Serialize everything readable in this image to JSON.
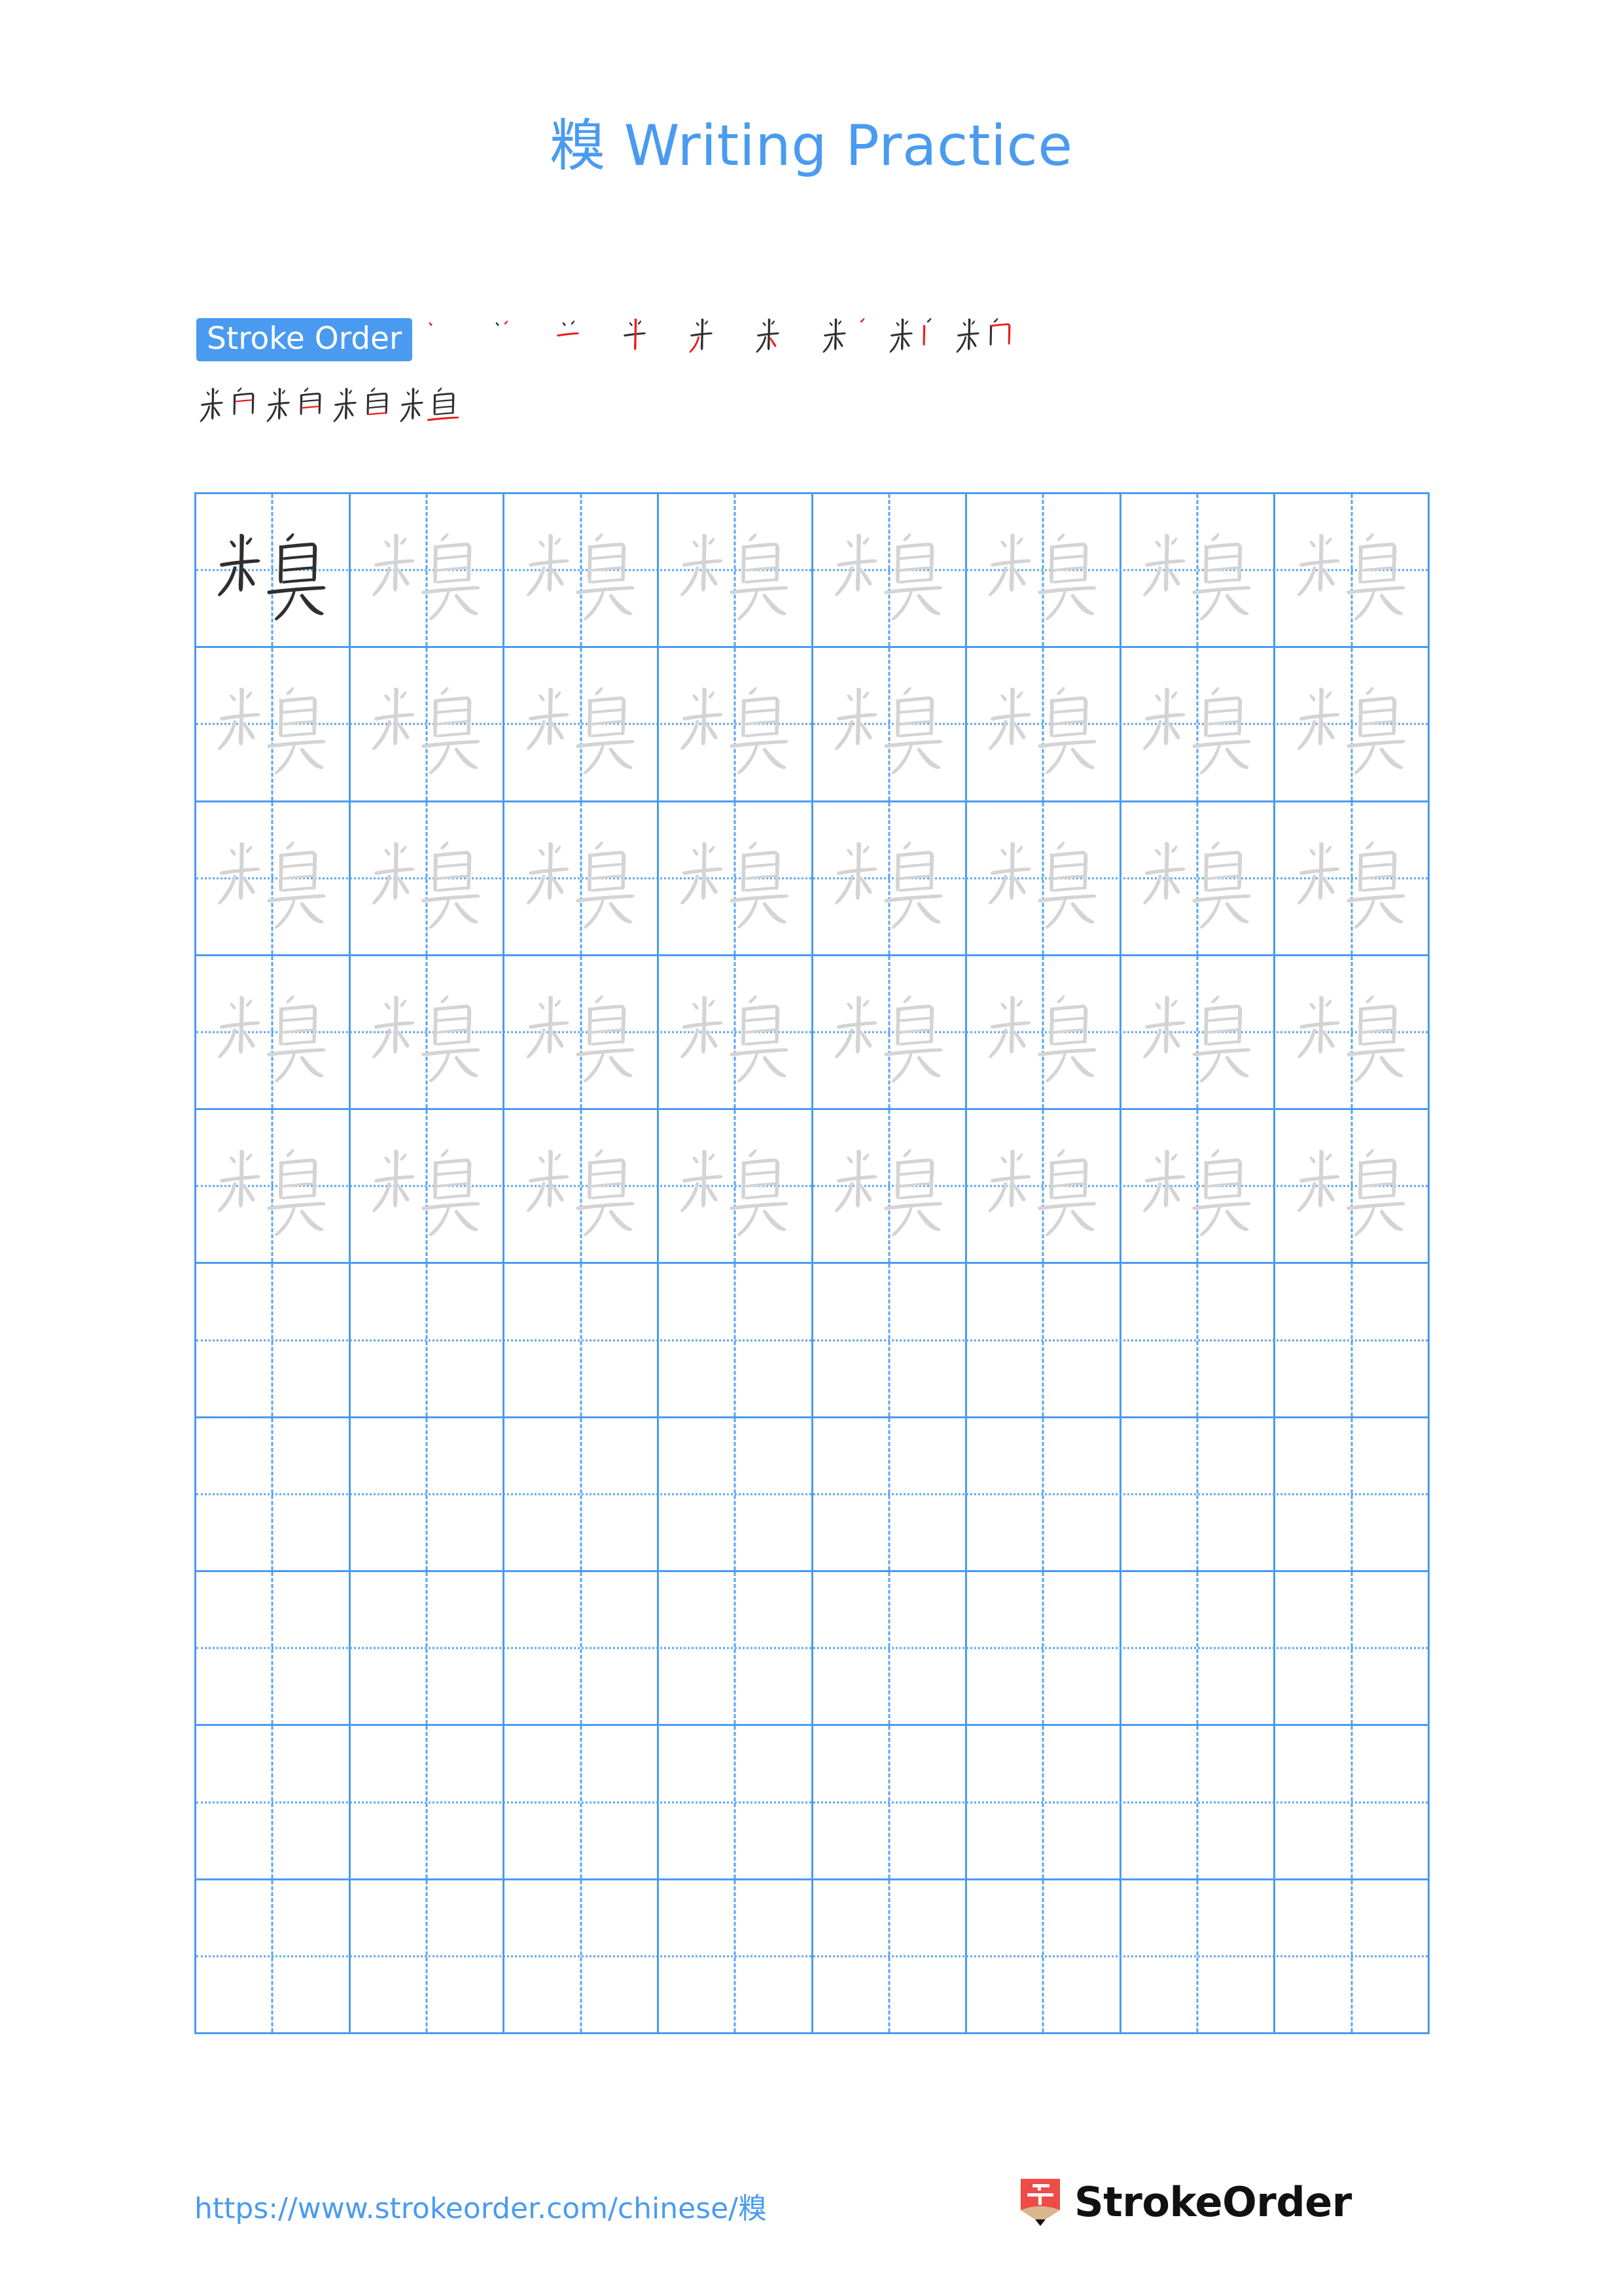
{
  "document": {
    "character": "糗",
    "title_suffix": " Writing Practice",
    "title_full": "糗 Writing Practice"
  },
  "stroke_order": {
    "label": "Stroke Order",
    "total_strokes": 13,
    "steps": [
      {
        "index": 1,
        "new_stroke": "dot"
      },
      {
        "index": 2,
        "new_stroke": "dot-right"
      },
      {
        "index": 3,
        "new_stroke": "heng"
      },
      {
        "index": 4,
        "new_stroke": "shu"
      },
      {
        "index": 5,
        "new_stroke": "pie-left"
      },
      {
        "index": 6,
        "new_stroke": "dot-lower-left"
      },
      {
        "index": 7,
        "new_stroke": "pie-upper-right"
      },
      {
        "index": 8,
        "new_stroke": "na"
      },
      {
        "index": 9,
        "new_stroke": "pie-right-top"
      },
      {
        "index": 10,
        "new_stroke": "shu-right"
      },
      {
        "index": 11,
        "new_stroke": "heng-inner"
      },
      {
        "index": 12,
        "new_stroke": "heng-base"
      },
      {
        "index": 13,
        "new_stroke": "heng-long"
      }
    ],
    "row1_count": 9,
    "row2_count": 4
  },
  "practice_grid": {
    "rows": 10,
    "columns": 8,
    "filled_rows": 5,
    "empty_rows": 5,
    "cells": [
      [
        "dark",
        "light",
        "light",
        "light",
        "light",
        "light",
        "light",
        "light"
      ],
      [
        "light",
        "light",
        "light",
        "light",
        "light",
        "light",
        "light",
        "light"
      ],
      [
        "light",
        "light",
        "light",
        "light",
        "light",
        "light",
        "light",
        "light"
      ],
      [
        "light",
        "light",
        "light",
        "light",
        "light",
        "light",
        "light",
        "light"
      ],
      [
        "light",
        "light",
        "light",
        "light",
        "light",
        "light",
        "light",
        "light"
      ],
      [
        "empty",
        "empty",
        "empty",
        "empty",
        "empty",
        "empty",
        "empty",
        "empty"
      ],
      [
        "empty",
        "empty",
        "empty",
        "empty",
        "empty",
        "empty",
        "empty",
        "empty"
      ],
      [
        "empty",
        "empty",
        "empty",
        "empty",
        "empty",
        "empty",
        "empty",
        "empty"
      ],
      [
        "empty",
        "empty",
        "empty",
        "empty",
        "empty",
        "empty",
        "empty",
        "empty"
      ],
      [
        "empty",
        "empty",
        "empty",
        "empty",
        "empty",
        "empty",
        "empty",
        "empty"
      ]
    ]
  },
  "footer": {
    "url": "https://www.strokeorder.com/chinese/糗",
    "brand_name": "StrokeOrder",
    "brand_logo_char": "字"
  },
  "colors": {
    "accent_blue": "#4a9bf0",
    "grid_line": "#4a9bf0",
    "guide_line": "#5aa5f2",
    "stroke_new": "#ee1c1c",
    "stroke_done": "#2f2f2f",
    "trace_gray": "#d4d4d4",
    "logo_red": "#ef4b48"
  }
}
